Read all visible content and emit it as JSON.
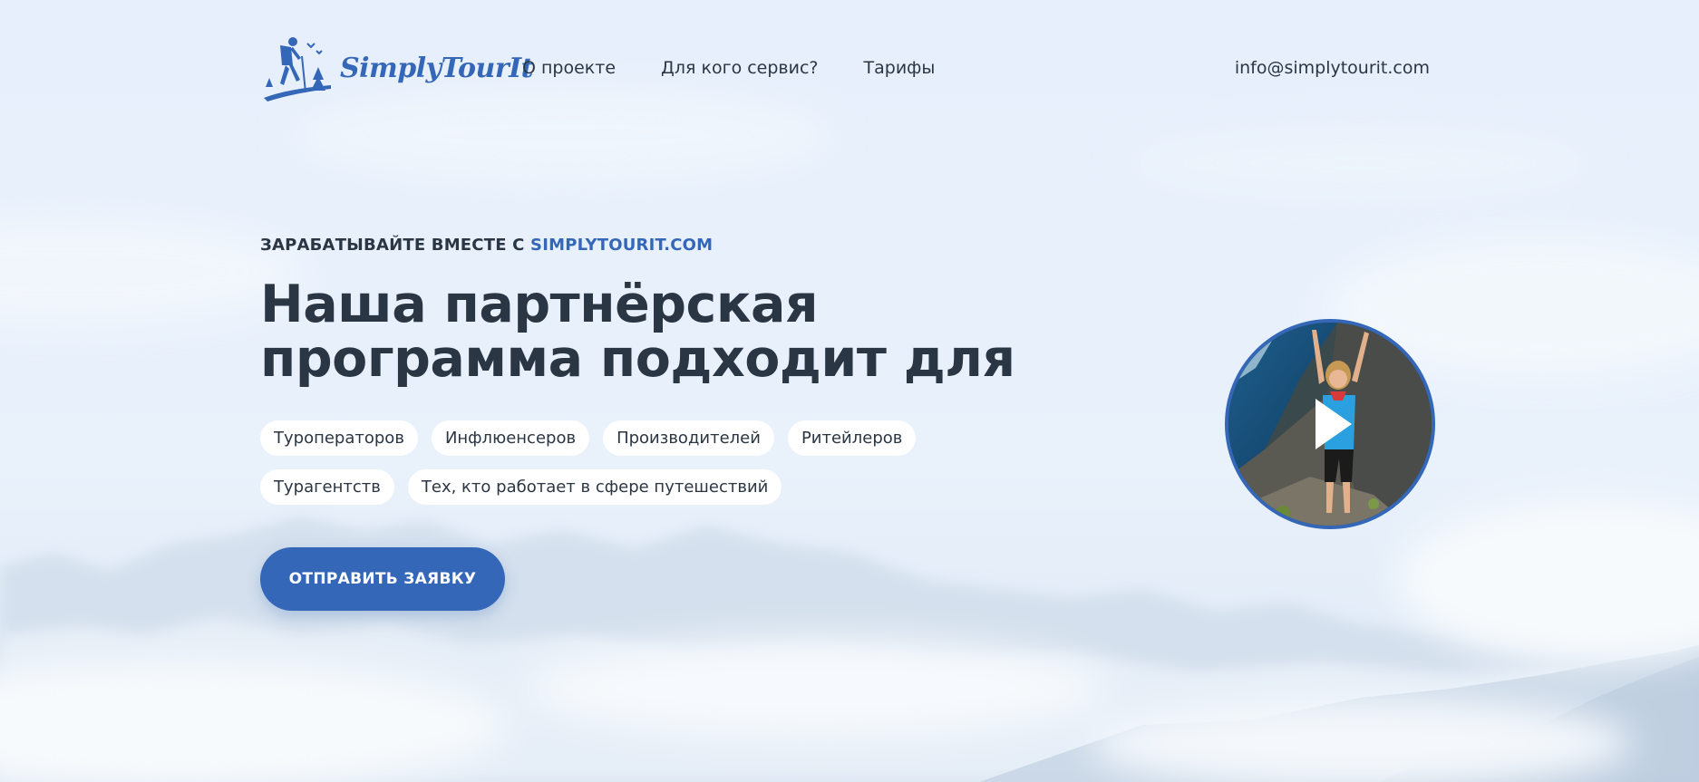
{
  "brand": {
    "name": "SimplyTourIt",
    "color": "#3567b8"
  },
  "nav": {
    "items": [
      {
        "label": "О проекте"
      },
      {
        "label": "Для кого сервис?"
      },
      {
        "label": "Тарифы"
      }
    ],
    "email": "info@simplytourit.com"
  },
  "hero": {
    "eyebrow_prefix": "ЗАРАБАТЫВАЙТЕ ВМЕСТЕ С",
    "eyebrow_accent": "SIMPLYTOURIT.COM",
    "headline": "Наша партнёрская программа подходит для",
    "chips": [
      "Туроператоров",
      "Инфлюенсеров",
      "Производителей",
      "Ритейлеров",
      "Турагентств",
      "Тех, кто работает в сфере путешествий"
    ],
    "cta_label": "ОТПРАВИТЬ ЗАЯВКУ"
  },
  "video": {
    "icon": "play-icon"
  },
  "colors": {
    "accent": "#3567b8",
    "text": "#2b3645",
    "chip_bg": "#ffffff"
  }
}
